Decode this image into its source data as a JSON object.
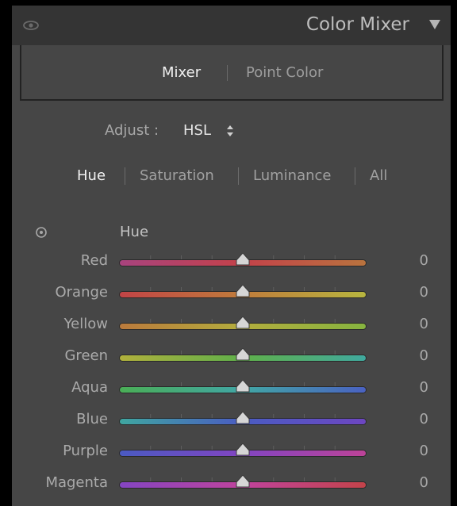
{
  "panel": {
    "title": "Color Mixer",
    "visibility_icon": "eye-icon",
    "collapse_icon": "triangle-down-icon"
  },
  "mode_tabs": [
    {
      "label": "Mixer",
      "active": true
    },
    {
      "label": "Point Color",
      "active": false
    }
  ],
  "adjust": {
    "label": "Adjust :",
    "value": "HSL",
    "stepper_icon": "up-down-stepper-icon"
  },
  "hsl_tabs": [
    {
      "label": "Hue",
      "active": true
    },
    {
      "label": "Saturation",
      "active": false
    },
    {
      "label": "Luminance",
      "active": false
    },
    {
      "label": "All",
      "active": false
    }
  ],
  "section": {
    "title": "Hue",
    "target_icon": "target-adjustment-icon"
  },
  "sliders": [
    {
      "label": "Red",
      "value": "0",
      "colors": [
        "#a8437e",
        "#c4424a",
        "#b9733e"
      ]
    },
    {
      "label": "Orange",
      "value": "0",
      "colors": [
        "#c24446",
        "#c07c3b",
        "#b8b63f"
      ]
    },
    {
      "label": "Yellow",
      "value": "0",
      "colors": [
        "#bb7a3c",
        "#b3ad3d",
        "#86b43f"
      ]
    },
    {
      "label": "Green",
      "value": "0",
      "colors": [
        "#b0b03c",
        "#5fb04a",
        "#40a99e"
      ]
    },
    {
      "label": "Aqua",
      "value": "0",
      "colors": [
        "#4aae56",
        "#41a6a4",
        "#4a62c2"
      ]
    },
    {
      "label": "Blue",
      "value": "0",
      "colors": [
        "#3fa6a0",
        "#4a5cc2",
        "#6d46c1"
      ]
    },
    {
      "label": "Purple",
      "value": "0",
      "colors": [
        "#4a5ac2",
        "#8245c2",
        "#bd4398"
      ]
    },
    {
      "label": "Magenta",
      "value": "0",
      "colors": [
        "#8445c2",
        "#c0439d",
        "#c4434a"
      ]
    }
  ],
  "slider_range": {
    "min": -100,
    "max": 100
  },
  "theme": {
    "panel_bg": "#464646",
    "header_bg": "#343434",
    "active_text": "#f0f0f0",
    "inactive_text": "#9d9d9d"
  }
}
